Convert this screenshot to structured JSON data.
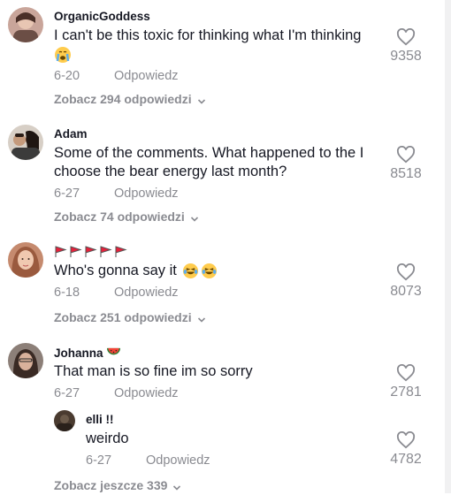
{
  "comments": [
    {
      "username": "OrganicGoddess",
      "text_line1": "I can't be this toxic for thinking what I'm thinking",
      "emoji": "crying-face",
      "date": "6-20",
      "reply_label": "Odpowiedz",
      "likes": "9358",
      "view_replies": "Zobacz 294 odpowiedzi"
    },
    {
      "username": "Adam",
      "text_line1": "Some of the comments. What happened to the I",
      "text_line2": "choose the bear energy last month?",
      "date": "6-27",
      "reply_label": "Odpowiedz",
      "likes": "8518",
      "view_replies": "Zobacz 74 odpowiedzi"
    },
    {
      "username_emoji": "five-red-flags",
      "text": "Who's gonna say it",
      "emoji": "two-laughing-faces",
      "date": "6-18",
      "reply_label": "Odpowiedz",
      "likes": "8073",
      "view_replies": "Zobacz 251 odpowiedzi"
    },
    {
      "username": "Johanna",
      "username_emoji": "watermelon",
      "text": "That man is so fine im so sorry",
      "date": "6-27",
      "reply_label": "Odpowiedz",
      "likes": "2781",
      "reply": {
        "username": "elli !!",
        "text": "weirdo",
        "date": "6-27",
        "reply_label": "Odpowiedz",
        "likes": "4782"
      },
      "view_more": "Zobacz jeszcze 339"
    }
  ],
  "colors": {
    "text": "#161823",
    "secondary": "#8a8b91",
    "flag": "#e6213b"
  }
}
